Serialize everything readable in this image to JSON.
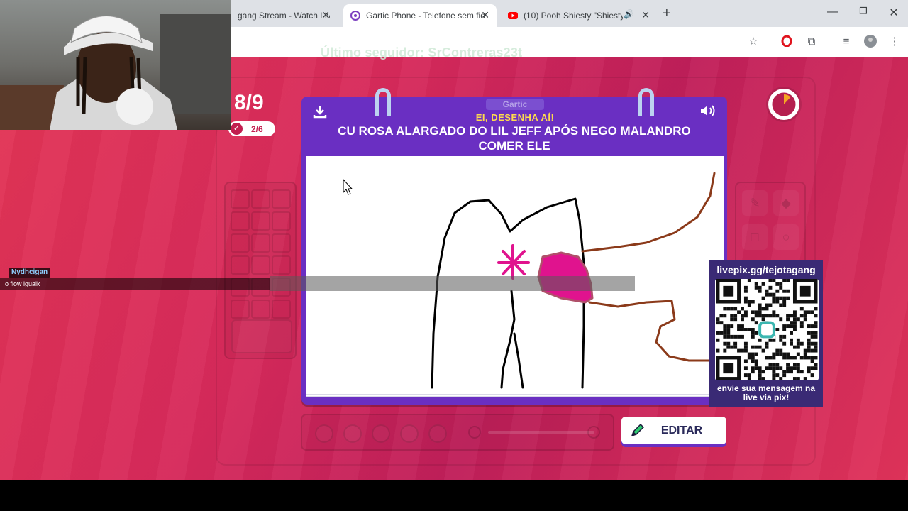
{
  "browser": {
    "tabs": [
      {
        "title": "gang Stream - Watch Live",
        "icon": "stream-favicon"
      },
      {
        "title": "Gartic Phone - Telefone sem fio",
        "icon": "gartic-favicon",
        "active": true
      },
      {
        "title": "(10) Pooh Shiesty \"Shiesty S",
        "icon": "youtube-favicon"
      }
    ],
    "new_tab_label": "+",
    "window_controls": [
      "minimize",
      "restore",
      "close"
    ]
  },
  "overlay": {
    "follower_text": "Último seguidor: SrContreras23t",
    "chat": {
      "user": "Nydhcigan",
      "message": "o flow igualk"
    },
    "qr": {
      "url": "livepix.gg/tejotagang",
      "message_line1": "envie sua mensagem na",
      "message_line2": "live via pix!"
    }
  },
  "game": {
    "round": "8/9",
    "progress": "2/6",
    "brand": "Gartic",
    "prompt_header": "EI, DESENHA AÍ!",
    "prompt_line1": "CU ROSA ALARGADO DO LIL JEFF APÓS NEGO MALANDRO",
    "prompt_line2": "COMER ELE",
    "edit_button": "EDITAR",
    "timer_fraction_elapsed": 0.12,
    "colors": {
      "accent_purple": "#6a2fc2",
      "background": "#d72a5b",
      "timer": "#f5a623"
    }
  }
}
